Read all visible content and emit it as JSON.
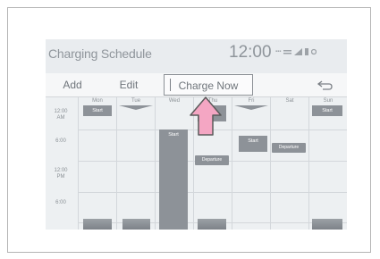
{
  "header": {
    "title": "Charging Schedule",
    "clock": "12:00"
  },
  "toolbar": {
    "add_label": "Add",
    "edit_label": "Edit",
    "charge_now_label": "Charge Now"
  },
  "schedule": {
    "days": [
      "Mon",
      "Tue",
      "Wed",
      "Thu",
      "Fri",
      "Sat",
      "Sun"
    ],
    "times": [
      {
        "line1": "12:00",
        "line2": "AM"
      },
      {
        "line1": "6:00",
        "line2": ""
      },
      {
        "line1": "12:00",
        "line2": "PM"
      },
      {
        "line1": "6:00",
        "line2": ""
      }
    ],
    "start_label": "Start",
    "departure_label": "Departure"
  },
  "colors": {
    "screen_bg": "#e9ecef",
    "block": "#8d9298",
    "arrow_fill": "#f4a6c3",
    "arrow_stroke": "#5a5a5a"
  },
  "icons": [
    "back-arrow-icon",
    "signal-icon",
    "battery-icon"
  ]
}
